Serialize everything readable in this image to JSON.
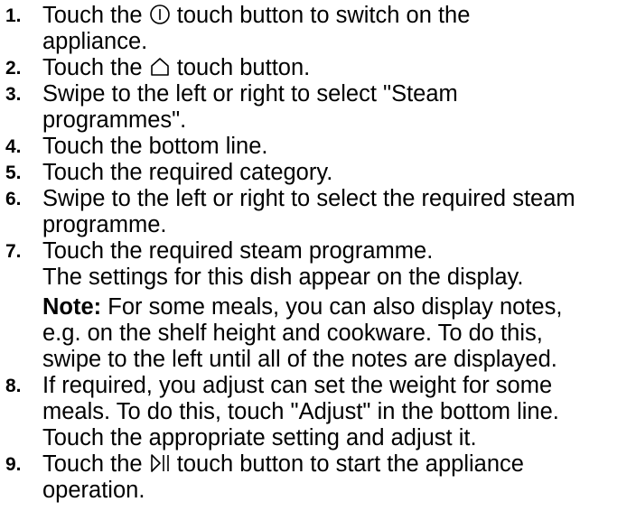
{
  "steps": [
    {
      "number": "1.",
      "lines": [
        "Touch the",
        "touch button to switch on the",
        "appliance."
      ],
      "icon": "power-icon"
    },
    {
      "number": "2.",
      "lines": [
        "Touch the",
        "touch button."
      ],
      "icon": "home-icon"
    },
    {
      "number": "3.",
      "lines": [
        "Swipe to the left or right to select \"Steam",
        "programmes\"."
      ]
    },
    {
      "number": "4.",
      "lines": [
        "Touch the bottom line."
      ]
    },
    {
      "number": "5.",
      "lines": [
        "Touch the required category."
      ]
    },
    {
      "number": "6.",
      "lines": [
        "Swipe to the left or right to select the required steam",
        "programme."
      ]
    },
    {
      "number": "7.",
      "lines": [
        "Touch the required steam programme."
      ],
      "result": "The settings for this dish appear on the display.",
      "note_label": "Note:",
      "note_lines": [
        "For some meals, you can also display notes,",
        "e.g. on the shelf height and cookware. To do this,",
        "swipe to the left until all of the notes are displayed."
      ]
    },
    {
      "number": "8.",
      "lines": [
        "If required, you adjust can set the weight for some",
        "meals. To do this, touch \"Adjust\" in the bottom line.",
        "Touch the appropriate setting and adjust it."
      ]
    },
    {
      "number": "9.",
      "lines": [
        "Touch the",
        "touch button to start the appliance",
        "operation."
      ],
      "icon": "start-pause-icon"
    }
  ]
}
